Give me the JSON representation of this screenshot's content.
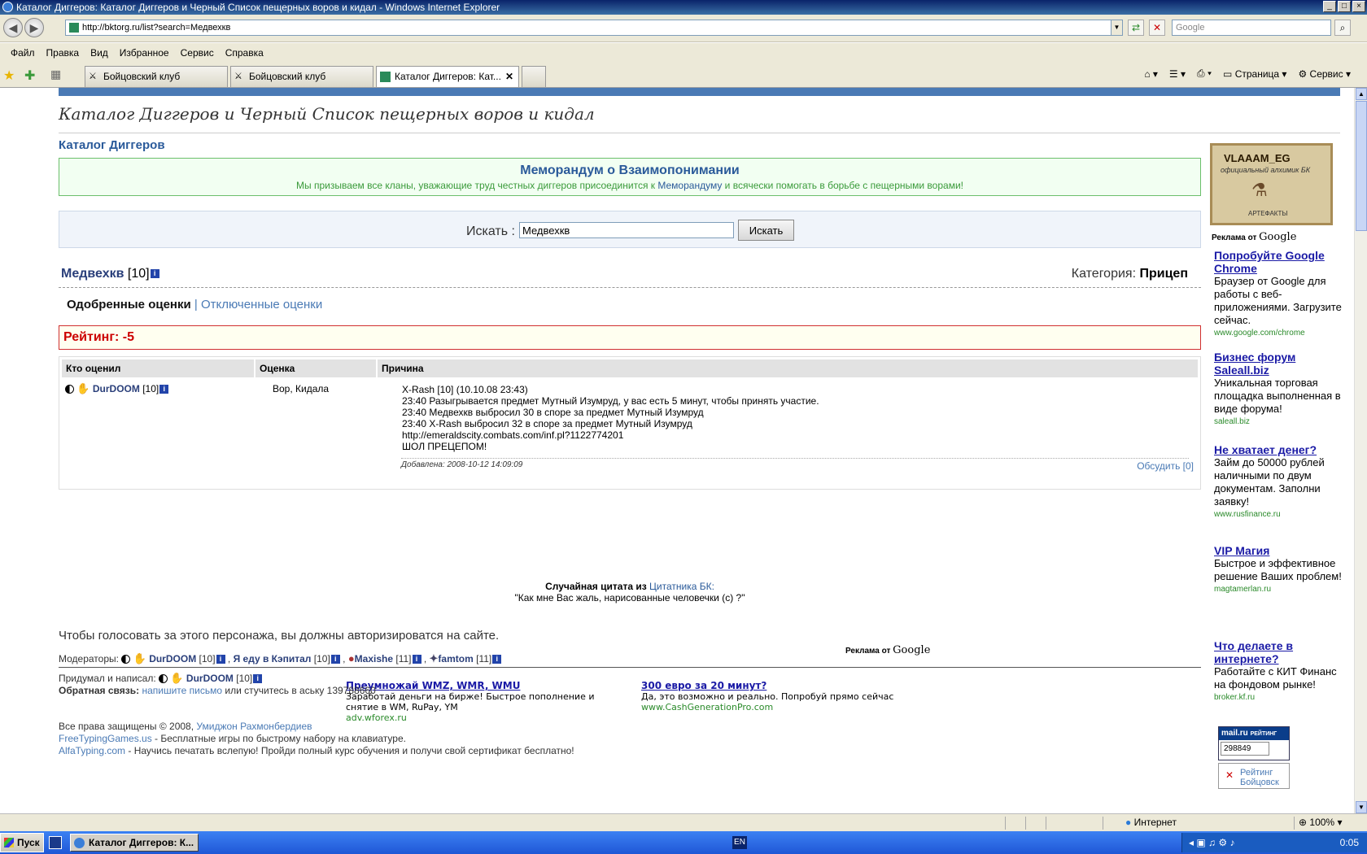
{
  "window": {
    "title": "Каталог Диггеров: Каталог Диггеров и Черный Список пещерных воров и кидал - Windows Internet Explorer"
  },
  "address": {
    "url": "http://bktorg.ru/list?search=Медвехкв",
    "search_placeholder": "Google"
  },
  "menu": [
    "Файл",
    "Правка",
    "Вид",
    "Избранное",
    "Сервис",
    "Справка"
  ],
  "tabs": [
    {
      "label": "Бойцовский клуб"
    },
    {
      "label": "Бойцовский клуб"
    },
    {
      "label": "Каталог Диггеров: Кат..."
    }
  ],
  "tools": {
    "page": "Страница",
    "service": "Сервис"
  },
  "site": {
    "title": "Каталог Диггеров и Черный Список пещерных воров и кидал",
    "breadcrumb": "Каталог Диггеров",
    "memo_title": "Меморандум о Взаимопонимании",
    "memo_text_1": "Мы призываем все кланы, уважающие труд честных диггеров присоединится к ",
    "memo_link": "Меморандуму",
    "memo_text_2": " и всячески помогать в борьбе с пещерными ворами!",
    "search_label": "Искать :",
    "search_value": "Медвехкв",
    "search_button": "Искать"
  },
  "character": {
    "name": "Медвехкв",
    "level": "[10]",
    "category_label": "Категория:",
    "category": "Прицеп"
  },
  "rating_tabs": {
    "approved": "Одобренные оценки",
    "sep": "|",
    "disabled": "Отключенные оценки"
  },
  "rating": "Рейтинг: -5",
  "table": {
    "headers": [
      "Кто оценил",
      "Оценка",
      "Причина"
    ],
    "row": {
      "user": "DurDOOM",
      "user_level": "[10]",
      "mark": "Вор, Кидала",
      "reason": [
        "X-Rash [10] (10.10.08 23:43)",
        "23:40 Разыгрывается предмет Мутный Изумруд, у вас есть 5 минут, чтобы принять участие.",
        "23:40 Медвехкв выбросил 30 в споре за предмет Мутный Изумруд",
        "23:40 X-Rash выбросил 32 в споре за предмет Мутный Изумруд",
        "http://emeraldscity.combats.com/inf.pl?1122774201",
        "ШОЛ ПРЕЦЕПОМ!"
      ],
      "added": "Добавлена: 2008-10-12 14:09:09",
      "discuss": "Обсудить [0]"
    }
  },
  "quote": {
    "prefix": "Случайная цитата из ",
    "link": "Цитатника БК:",
    "text": "\"Как мне Вас жаль, нарисованные человечки (с) ?\""
  },
  "vote_notice": "Чтобы голосовать за этого персонажа, вы должны авторизироватся на сайте.",
  "moderators": {
    "label": "Модераторы:",
    "list": [
      {
        "name": "DurDOOM",
        "lvl": "[10]"
      },
      {
        "name": "Я еду в Кэпитал",
        "lvl": "[10]"
      },
      {
        "name": "Maxishe",
        "lvl": "[11]"
      },
      {
        "name": "famtom",
        "lvl": "[11]"
      }
    ]
  },
  "ads_bottom": [
    {
      "title": "Преумножай WMZ, WMR, WMU",
      "desc": "Заработай деньги на бирже! Быстрое пополнение и снятие в WM, RuPay, YM",
      "url": "adv.wforex.ru"
    },
    {
      "title": "300 евро за 20 минут?",
      "desc": "Да, это возможно и реально. Попробуй прямо сейчас",
      "url": "www.CashGenerationPro.com"
    }
  ],
  "google_ads_label": "Реклама от",
  "google_word": "Google",
  "footer": {
    "author_label": "Придумал и написал:",
    "author": "DurDOOM",
    "author_lvl": "[10]",
    "feedback_label": "Обратная связь:",
    "feedback_link": "напишите письмо",
    "feedback_rest": " или стучитесь в аську 139788660",
    "rights": "Все права защищены © 2008, ",
    "rights_link": "Умиджон Рахмонбердиев",
    "ft_link": "FreeTypingGames.us",
    "ft_text": " - Бесплатные игры по быстрому набору на клавиатуре.",
    "at_link": "AlfaTyping.com",
    "at_text": " - Научись печатать вслепую! Пройди полный курс обучения и получи свой сертификат бесплатно!"
  },
  "banner": {
    "name": "VLAAAM_EG",
    "sub": "официальный алхимик БК",
    "art": "АРТЕФАКТЫ"
  },
  "side_ads": [
    {
      "title": "Попробуйте Google Chrome",
      "desc": "Браузер от Google для работы с веб-приложениями. Загрузите сейчас.",
      "url": "www.google.com/chrome"
    },
    {
      "title": "Бизнес форум Saleall.biz",
      "desc": "Уникальная торговая площадка выполненная в виде форума!",
      "url": "saleall.biz"
    },
    {
      "title": "Не хватает денег?",
      "desc": "Займ до 50000 рублей наличными по двум документам. Заполни заявку!",
      "url": "www.rusfinance.ru"
    },
    {
      "title": "VIP Магия",
      "desc": "Быстрое и эффективное решение Ваших проблем!",
      "url": "magtamerlan.ru"
    },
    {
      "title": "Что делаете в интернете?",
      "desc": "Работайте с КИТ Финанс на фондовом рынке!",
      "url": "broker.kf.ru"
    }
  ],
  "counter": {
    "brand": "mail.ru",
    "sub": "РЕЙТИНГ",
    "value": "298849",
    "rating_label": "Рейтинг Бойцовск"
  },
  "statusbar": {
    "zone": "Интернет",
    "zoom": "100%"
  },
  "taskbar": {
    "start": "Пуск",
    "task": "Каталог Диггеров: К...",
    "lang": "EN",
    "clock": "0:05"
  }
}
